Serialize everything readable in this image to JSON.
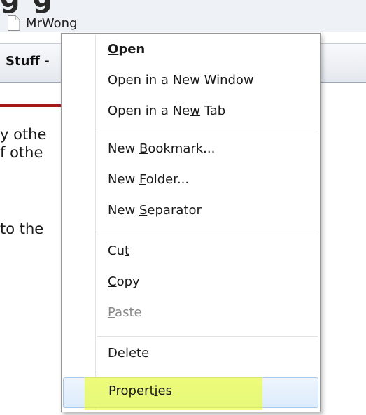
{
  "background": {
    "heading_fragment": "g  g",
    "bookmark": {
      "label": "MrWong",
      "icon": "page-icon"
    },
    "tab_title": "Stuff -",
    "text_lines": [
      "y othe",
      "f othe",
      "to the"
    ]
  },
  "context_menu": {
    "items": [
      {
        "pre": "",
        "key": "O",
        "post": "pen"
      },
      {
        "pre": "Open in a ",
        "key": "N",
        "post": "ew Window"
      },
      {
        "pre": "Open in a Ne",
        "key": "w",
        "post": " Tab"
      },
      {
        "pre": "New ",
        "key": "B",
        "post": "ookmark..."
      },
      {
        "pre": "New ",
        "key": "F",
        "post": "older..."
      },
      {
        "pre": "New ",
        "key": "S",
        "post": "eparator"
      },
      {
        "pre": "Cu",
        "key": "t",
        "post": ""
      },
      {
        "pre": "",
        "key": "C",
        "post": "opy"
      },
      {
        "pre": "",
        "key": "P",
        "post": "aste"
      },
      {
        "pre": "",
        "key": "D",
        "post": "elete"
      },
      {
        "pre": "Propert",
        "key": "i",
        "post": "es"
      }
    ]
  },
  "colors": {
    "highlight": "#eeff28",
    "hover_border": "#a8c9ee",
    "accent_rule": "#a31818"
  }
}
